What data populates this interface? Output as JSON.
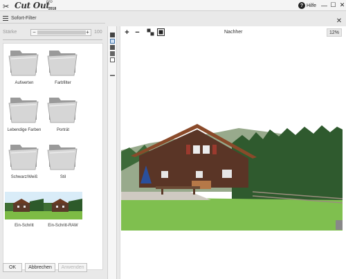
{
  "app": {
    "logo_name": "Cut Out",
    "logo_pro": "pro",
    "logo_year": "2018",
    "help_label": "Hilfe"
  },
  "window_controls": {
    "minimize": "—",
    "maximize": "☐",
    "close": "✕"
  },
  "panel": {
    "title": "Sofort-Filter",
    "strength_label": "Stärke",
    "strength_value": "100",
    "strength_level": 1.0,
    "minus": "−",
    "plus": "+"
  },
  "filters": [
    {
      "label": "Aufwerten",
      "kind": "folder"
    },
    {
      "label": "Farbfilter",
      "kind": "folder"
    },
    {
      "label": "Lebendige Farben",
      "kind": "folder"
    },
    {
      "label": "Porträt",
      "kind": "folder"
    },
    {
      "label": "Schwarz/Weiß",
      "kind": "folder"
    },
    {
      "label": "Stil",
      "kind": "folder"
    },
    {
      "label": "Ein-Schritt",
      "kind": "photo"
    },
    {
      "label": "Ein-Schritt-RAW",
      "kind": "photo"
    }
  ],
  "buttons": {
    "ok": "OK",
    "cancel": "Abbrechen",
    "apply": "Anwenden"
  },
  "view": {
    "title": "Nachher",
    "zoom": "12%",
    "zoom_in": "+",
    "zoom_out": "−",
    "close": "✕"
  },
  "colors": {
    "panel_bg": "#e9e9e9",
    "canvas_bg": "#ffffff",
    "folder": "#c9c9c9"
  }
}
